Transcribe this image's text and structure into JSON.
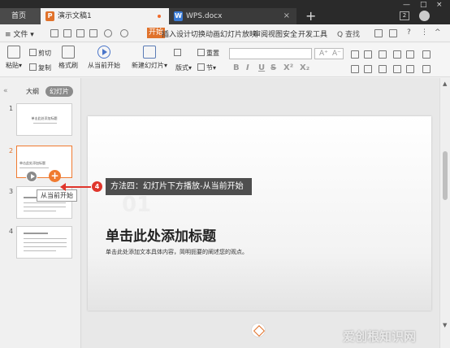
{
  "tabs": {
    "home": "首页",
    "doc1": "演示文稿1",
    "doc1_icon": "P",
    "doc2": "WPS.docx",
    "doc2_icon": "W",
    "new_tab": "+"
  },
  "window": {
    "badge": "2",
    "minimize": "—",
    "maximize": "□",
    "close": "×"
  },
  "menubar": {
    "file": "≡ 文件 ▾",
    "tabs": [
      "开始",
      "插入",
      "设计",
      "切换",
      "动画",
      "幻灯片放映",
      "审阅",
      "视图",
      "安全",
      "开发工具"
    ],
    "search": "Q 查找",
    "help": "?",
    "more": "⋮",
    "collapse": "^"
  },
  "ribbon": {
    "paste": "粘贴▾",
    "cut": "剪切",
    "copy": "复制",
    "format_painter": "格式刷",
    "from_current": "从当前开始",
    "new_slide": "新建幻灯片▾",
    "layout": "版式▾",
    "section": "节▾",
    "reset": "重置",
    "font_sizes": [
      "A⁺",
      "A⁻"
    ],
    "format_glyphs": [
      "B",
      "I",
      "U",
      "S",
      "X²",
      "X₂"
    ]
  },
  "left_pane": {
    "collapse": "«",
    "outline": "大纲",
    "slides": "幻灯片",
    "thumbnails": [
      {
        "num": "1",
        "title": "单击此处添加标题"
      },
      {
        "num": "2",
        "title": "单击此处添加标题"
      },
      {
        "num": "3",
        "title": ""
      },
      {
        "num": "4",
        "title": ""
      }
    ],
    "add": "+",
    "tooltip": "从当前开始"
  },
  "slide": {
    "number": "01",
    "title": "单击此处添加标题",
    "subtitle": "单击此处添加文本具体内容，简明扼要的阐述您的观点。"
  },
  "callout": {
    "badge": "4",
    "text": "方法四：幻灯片下方播放-从当前开始"
  },
  "watermark": "爱创根知识网",
  "colors": {
    "accent": "#e0722b",
    "callout_red": "#e0362c",
    "tabbar": "#2a2a2a"
  }
}
